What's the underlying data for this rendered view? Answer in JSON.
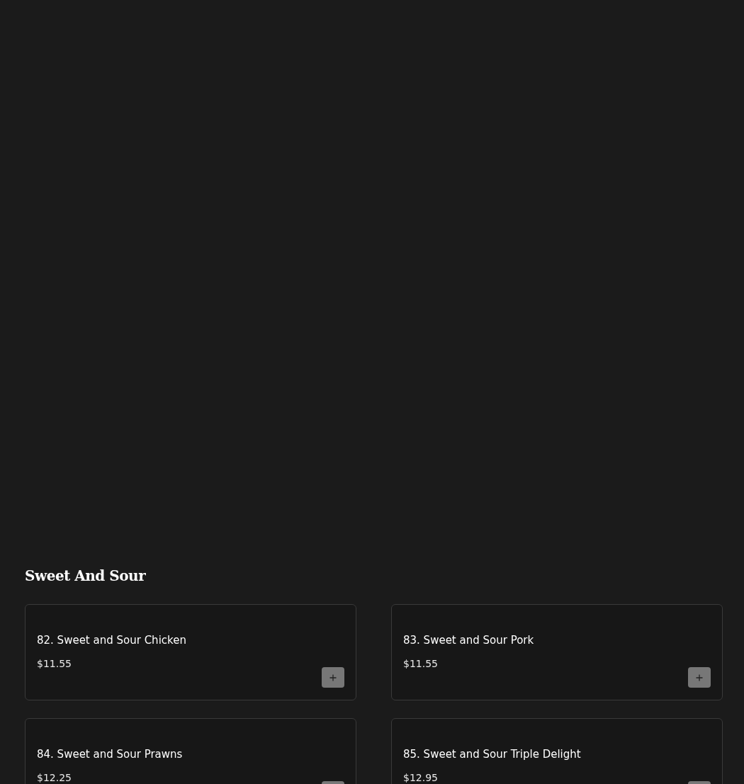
{
  "section": {
    "title": "Sweet And Sour"
  },
  "items": [
    {
      "name": "82. Sweet and Sour Chicken",
      "price": "$11.55"
    },
    {
      "name": "83. Sweet and Sour Pork",
      "price": "$11.55"
    },
    {
      "name": "84. Sweet and Sour Prawns",
      "price": "$12.25"
    },
    {
      "name": "85. Sweet and Sour Triple Delight",
      "price": "$12.95"
    }
  ]
}
